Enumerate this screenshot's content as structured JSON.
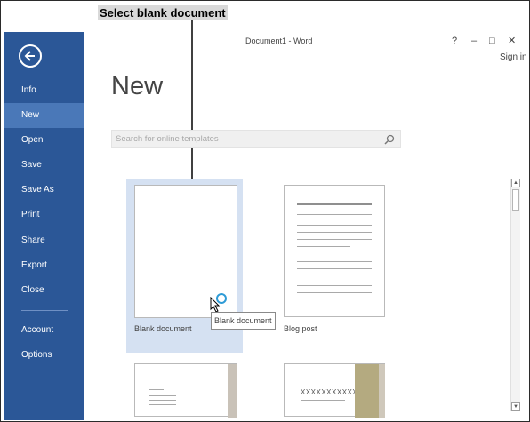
{
  "callout": {
    "text": "Select blank document"
  },
  "window": {
    "title": "Document1 - Word",
    "help_label": "?",
    "minimize_label": "–",
    "maximize_label": "□",
    "close_label": "✕",
    "sign_in": "Sign in"
  },
  "sidebar": {
    "back_icon": "back-arrow-circle-icon",
    "items": [
      {
        "label": "Info"
      },
      {
        "label": "New",
        "active": true
      },
      {
        "label": "Open"
      },
      {
        "label": "Save"
      },
      {
        "label": "Save As"
      },
      {
        "label": "Print"
      },
      {
        "label": "Share"
      },
      {
        "label": "Export"
      },
      {
        "label": "Close"
      }
    ],
    "bottom_items": [
      {
        "label": "Account"
      },
      {
        "label": "Options"
      }
    ]
  },
  "main": {
    "heading": "New",
    "search": {
      "placeholder": "Search for online templates",
      "value": "",
      "icon": "search-icon"
    },
    "templates": [
      {
        "label": "Blank document",
        "selected": true
      },
      {
        "label": "Blog post"
      }
    ],
    "partial_templates": [
      {
        "preview_text": ""
      },
      {
        "preview_text": "XXXXXXXXXXX"
      }
    ],
    "tooltip": "Blank document"
  },
  "colors": {
    "sidebar_bg": "#2b5797",
    "sidebar_active": "#4a78b8",
    "selection_bg": "#d5e1f2",
    "spinner": "#2e9bd6"
  }
}
